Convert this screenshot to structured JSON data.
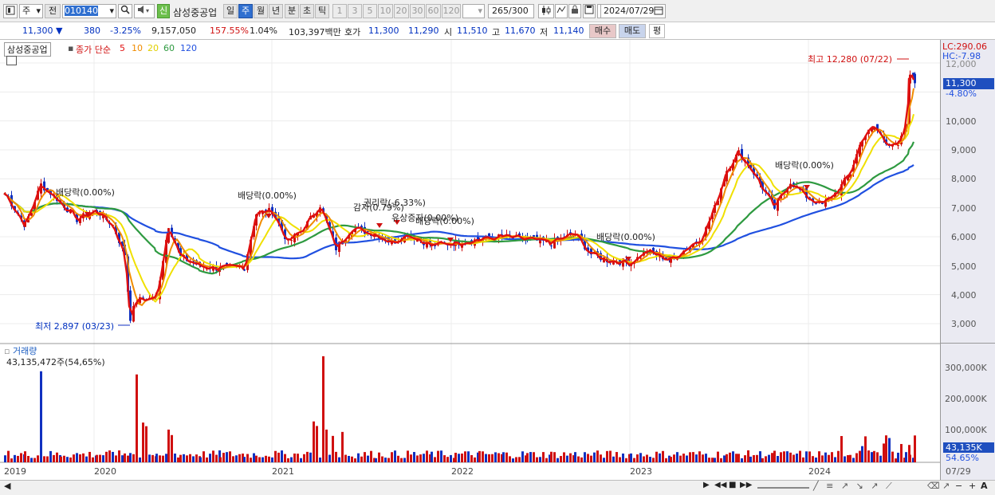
{
  "toolbar": {
    "period_select": "주",
    "prev_label": "전",
    "code_value": "010140",
    "new_badge": "신",
    "stock_name": "삼성중공업",
    "period_tabs": [
      "일",
      "주",
      "월",
      "년",
      "분",
      "초",
      "틱"
    ],
    "active_period": "주",
    "minute_options": [
      "1",
      "3",
      "5",
      "10",
      "20",
      "30",
      "60",
      "120"
    ],
    "count_value": "265",
    "count_total": "/300",
    "date_value": "2024/07/29"
  },
  "quote": {
    "price": "11,300 ▼",
    "change": "380",
    "change_pct": "-3.25%",
    "volume": "9,157,050",
    "vol_ratio": "157.55%",
    "turnover": "1.04%",
    "amount": "103,397백만",
    "ask_label": "호가",
    "ask_price": "11,300",
    "bid_price": "11,290",
    "open_label": "시",
    "open": "11,510",
    "high_label": "고",
    "high": "11,670",
    "low_label": "저",
    "low": "11,140",
    "buy_label": "매수",
    "sell_label": "매도",
    "eval_label": "평"
  },
  "chart_header": {
    "name": "삼성중공업",
    "ma_title": "종가 단순",
    "ma_periods": [
      "5",
      "10",
      "20",
      "60",
      "120"
    ],
    "ma_colors": [
      "#e01010",
      "#f08c00",
      "#f0e000",
      "#2e9a40",
      "#2050e0"
    ]
  },
  "price_axis": {
    "ticks": [
      "12,000",
      "11,000",
      "10,000",
      "9,000",
      "8,000",
      "7,000",
      "6,000",
      "5,000",
      "4,000",
      "3,000"
    ],
    "lc": "LC:290.06",
    "hc": "HC:-7.98",
    "current": "11,300",
    "current_pct": "-4.80%"
  },
  "annotations": {
    "high": "최고 12,280 (07/22)",
    "low": "최저 2,897 (03/23)",
    "events": [
      "배당락(0.00%)",
      "배당락(0.00%)",
      "권리락(-6.33%)",
      "감자(0.79%)",
      "유상증자(0.00%)",
      "배당락(0.00%)",
      "배당락(0.00%)",
      "배당락(0.00%)"
    ]
  },
  "volume_panel": {
    "title": "거래량",
    "value": "43,135,472주(54,65%)",
    "ticks": [
      "300,000K",
      "200,000K",
      "100,000K"
    ],
    "current": "43,135K",
    "current_pct": "54.65%"
  },
  "x_axis": {
    "labels": [
      "2019",
      "2020",
      "2021",
      "2022",
      "2023",
      "2024"
    ],
    "right_label": "07/29"
  },
  "colors": {
    "up": "#d01010",
    "down": "#1030c0",
    "ma5": "#e01010",
    "ma10": "#f08c00",
    "ma20": "#f0e000",
    "ma60": "#2e9a40",
    "ma120": "#2050e0"
  },
  "icons": [
    "chart-icon",
    "search-icon",
    "speaker-icon",
    "candle-icon",
    "lock-icon",
    "save-icon",
    "gear-icon",
    "calendar-icon"
  ]
}
